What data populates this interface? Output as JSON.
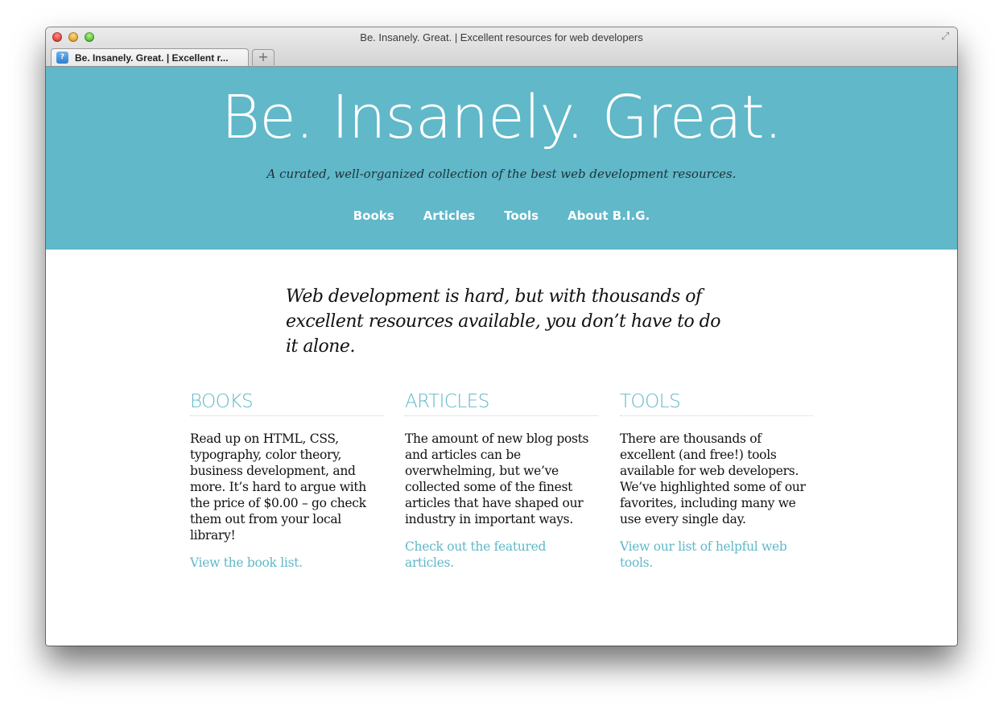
{
  "browser": {
    "window_title": "Be. Insanely. Great. | Excellent resources for web developers",
    "tab_label": "Be. Insanely. Great. | Excellent r...",
    "new_tab_symbol": "+",
    "fullscreen_symbol": "⤢",
    "favicon_symbol": "?"
  },
  "header": {
    "title": "Be. Insanely. Great.",
    "tagline": "A curated, well-organized collection of the best web development resources.",
    "nav": [
      {
        "label": "Books"
      },
      {
        "label": "Articles"
      },
      {
        "label": "Tools"
      },
      {
        "label": "About B.I.G."
      }
    ]
  },
  "intro": "Web development is hard, but with thousands of excellent resources available, you don’t have to do it alone.",
  "sections": [
    {
      "heading": "BOOKS",
      "body": "Read up on HTML, CSS, typography, color theory, business development, and more. It’s hard to argue with the price of $0.00 – go check them out from your local library!",
      "link": "View the book list."
    },
    {
      "heading": "ARTICLES",
      "body": "The amount of new blog posts and articles can be overwhelming, but we’ve collected some of the finest articles that have shaped our industry in important ways.",
      "link": "Check out the featured articles."
    },
    {
      "heading": "TOOLS",
      "body": "There are thousands of excellent (and free!) tools available for web developers. We’ve highlighted some of our favorites, including many we use every single day.",
      "link": "View our list of helpful web tools."
    }
  ],
  "colors": {
    "accent": "#60b8c9",
    "text": "#111111"
  }
}
